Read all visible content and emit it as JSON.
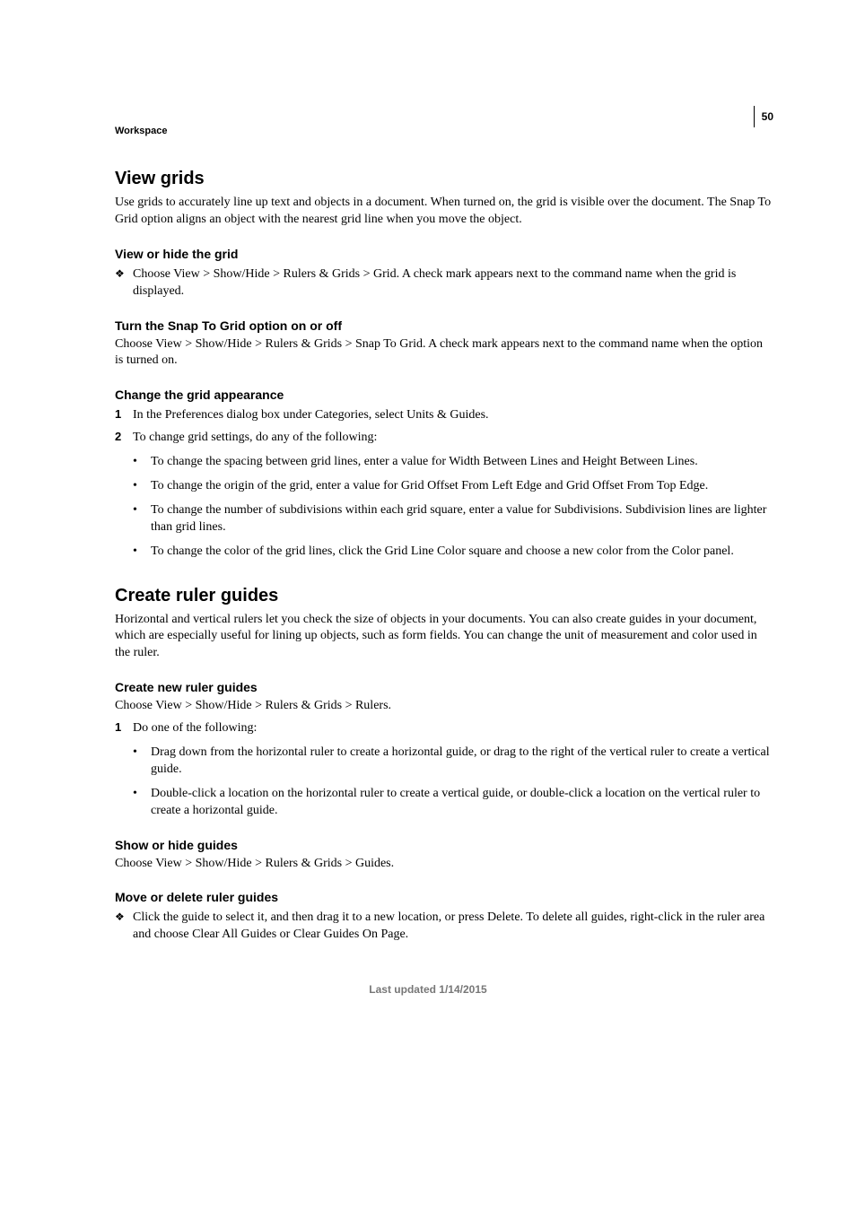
{
  "page_number": "50",
  "breadcrumb": "Workspace",
  "footer": "Last updated 1/14/2015",
  "sections": {
    "view_grids": {
      "title": "View grids",
      "intro": "Use grids to accurately line up text and objects in a document. When turned on, the grid is visible over the document. The Snap To Grid option aligns an object with the nearest grid line when you move the object.",
      "view_hide": {
        "title": "View or hide the grid",
        "text": "Choose View > Show/Hide > Rulers & Grids > Grid. A check mark appears next to the command name when the grid is displayed."
      },
      "snap": {
        "title": "Turn the Snap To Grid option on or off",
        "text": "Choose View > Show/Hide > Rulers & Grids > Snap To Grid. A check mark appears next to the command name when the option is turned on."
      },
      "change": {
        "title": "Change the grid appearance",
        "step1": "In the Preferences dialog box under Categories, select Units & Guides.",
        "step2": "To change grid settings, do any of the following:",
        "bullets": [
          "To change the spacing between grid lines, enter a value for Width Between Lines and Height Between Lines.",
          "To change the origin of the grid, enter a value for Grid Offset From Left Edge and Grid Offset From Top Edge.",
          "To change the number of subdivisions within each grid square, enter a value for Subdivisions. Subdivision lines are lighter than grid lines.",
          "To change the color of the grid lines, click the Grid Line Color square and choose a new color from the Color panel."
        ]
      }
    },
    "ruler_guides": {
      "title": "Create ruler guides",
      "intro": "Horizontal and vertical rulers let you check the size of objects in your documents. You can also create guides in your document, which are especially useful for lining up objects, such as form fields. You can change the unit of measurement and color used in the ruler.",
      "create": {
        "title": "Create new ruler guides",
        "text": "Choose View > Show/Hide > Rulers & Grids > Rulers.",
        "step1": "Do one of the following:",
        "bullets": [
          "Drag down from the horizontal ruler to create a horizontal guide, or drag to the right of the vertical ruler to create a vertical guide.",
          "Double-click a location on the horizontal ruler to create a vertical guide, or double-click a location on the vertical ruler to create a horizontal guide."
        ]
      },
      "show_hide": {
        "title": "Show or hide guides",
        "text": "Choose View > Show/Hide > Rulers & Grids > Guides."
      },
      "move_delete": {
        "title": "Move or delete ruler guides",
        "text": "Click the guide to select it, and then drag it to a new location, or press Delete. To delete all guides, right-click in the ruler area and choose Clear All Guides or Clear Guides On Page."
      }
    }
  }
}
